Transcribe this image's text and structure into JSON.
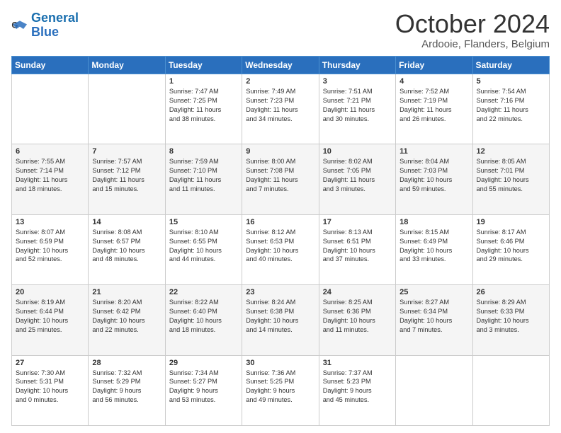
{
  "logo": {
    "line1": "General",
    "line2": "Blue"
  },
  "header": {
    "month": "October 2024",
    "location": "Ardooie, Flanders, Belgium"
  },
  "weekdays": [
    "Sunday",
    "Monday",
    "Tuesday",
    "Wednesday",
    "Thursday",
    "Friday",
    "Saturday"
  ],
  "rows": [
    [
      {
        "day": "",
        "text": ""
      },
      {
        "day": "",
        "text": ""
      },
      {
        "day": "1",
        "text": "Sunrise: 7:47 AM\nSunset: 7:25 PM\nDaylight: 11 hours\nand 38 minutes."
      },
      {
        "day": "2",
        "text": "Sunrise: 7:49 AM\nSunset: 7:23 PM\nDaylight: 11 hours\nand 34 minutes."
      },
      {
        "day": "3",
        "text": "Sunrise: 7:51 AM\nSunset: 7:21 PM\nDaylight: 11 hours\nand 30 minutes."
      },
      {
        "day": "4",
        "text": "Sunrise: 7:52 AM\nSunset: 7:19 PM\nDaylight: 11 hours\nand 26 minutes."
      },
      {
        "day": "5",
        "text": "Sunrise: 7:54 AM\nSunset: 7:16 PM\nDaylight: 11 hours\nand 22 minutes."
      }
    ],
    [
      {
        "day": "6",
        "text": "Sunrise: 7:55 AM\nSunset: 7:14 PM\nDaylight: 11 hours\nand 18 minutes."
      },
      {
        "day": "7",
        "text": "Sunrise: 7:57 AM\nSunset: 7:12 PM\nDaylight: 11 hours\nand 15 minutes."
      },
      {
        "day": "8",
        "text": "Sunrise: 7:59 AM\nSunset: 7:10 PM\nDaylight: 11 hours\nand 11 minutes."
      },
      {
        "day": "9",
        "text": "Sunrise: 8:00 AM\nSunset: 7:08 PM\nDaylight: 11 hours\nand 7 minutes."
      },
      {
        "day": "10",
        "text": "Sunrise: 8:02 AM\nSunset: 7:05 PM\nDaylight: 11 hours\nand 3 minutes."
      },
      {
        "day": "11",
        "text": "Sunrise: 8:04 AM\nSunset: 7:03 PM\nDaylight: 10 hours\nand 59 minutes."
      },
      {
        "day": "12",
        "text": "Sunrise: 8:05 AM\nSunset: 7:01 PM\nDaylight: 10 hours\nand 55 minutes."
      }
    ],
    [
      {
        "day": "13",
        "text": "Sunrise: 8:07 AM\nSunset: 6:59 PM\nDaylight: 10 hours\nand 52 minutes."
      },
      {
        "day": "14",
        "text": "Sunrise: 8:08 AM\nSunset: 6:57 PM\nDaylight: 10 hours\nand 48 minutes."
      },
      {
        "day": "15",
        "text": "Sunrise: 8:10 AM\nSunset: 6:55 PM\nDaylight: 10 hours\nand 44 minutes."
      },
      {
        "day": "16",
        "text": "Sunrise: 8:12 AM\nSunset: 6:53 PM\nDaylight: 10 hours\nand 40 minutes."
      },
      {
        "day": "17",
        "text": "Sunrise: 8:13 AM\nSunset: 6:51 PM\nDaylight: 10 hours\nand 37 minutes."
      },
      {
        "day": "18",
        "text": "Sunrise: 8:15 AM\nSunset: 6:49 PM\nDaylight: 10 hours\nand 33 minutes."
      },
      {
        "day": "19",
        "text": "Sunrise: 8:17 AM\nSunset: 6:46 PM\nDaylight: 10 hours\nand 29 minutes."
      }
    ],
    [
      {
        "day": "20",
        "text": "Sunrise: 8:19 AM\nSunset: 6:44 PM\nDaylight: 10 hours\nand 25 minutes."
      },
      {
        "day": "21",
        "text": "Sunrise: 8:20 AM\nSunset: 6:42 PM\nDaylight: 10 hours\nand 22 minutes."
      },
      {
        "day": "22",
        "text": "Sunrise: 8:22 AM\nSunset: 6:40 PM\nDaylight: 10 hours\nand 18 minutes."
      },
      {
        "day": "23",
        "text": "Sunrise: 8:24 AM\nSunset: 6:38 PM\nDaylight: 10 hours\nand 14 minutes."
      },
      {
        "day": "24",
        "text": "Sunrise: 8:25 AM\nSunset: 6:36 PM\nDaylight: 10 hours\nand 11 minutes."
      },
      {
        "day": "25",
        "text": "Sunrise: 8:27 AM\nSunset: 6:34 PM\nDaylight: 10 hours\nand 7 minutes."
      },
      {
        "day": "26",
        "text": "Sunrise: 8:29 AM\nSunset: 6:33 PM\nDaylight: 10 hours\nand 3 minutes."
      }
    ],
    [
      {
        "day": "27",
        "text": "Sunrise: 7:30 AM\nSunset: 5:31 PM\nDaylight: 10 hours\nand 0 minutes."
      },
      {
        "day": "28",
        "text": "Sunrise: 7:32 AM\nSunset: 5:29 PM\nDaylight: 9 hours\nand 56 minutes."
      },
      {
        "day": "29",
        "text": "Sunrise: 7:34 AM\nSunset: 5:27 PM\nDaylight: 9 hours\nand 53 minutes."
      },
      {
        "day": "30",
        "text": "Sunrise: 7:36 AM\nSunset: 5:25 PM\nDaylight: 9 hours\nand 49 minutes."
      },
      {
        "day": "31",
        "text": "Sunrise: 7:37 AM\nSunset: 5:23 PM\nDaylight: 9 hours\nand 45 minutes."
      },
      {
        "day": "",
        "text": ""
      },
      {
        "day": "",
        "text": ""
      }
    ]
  ]
}
